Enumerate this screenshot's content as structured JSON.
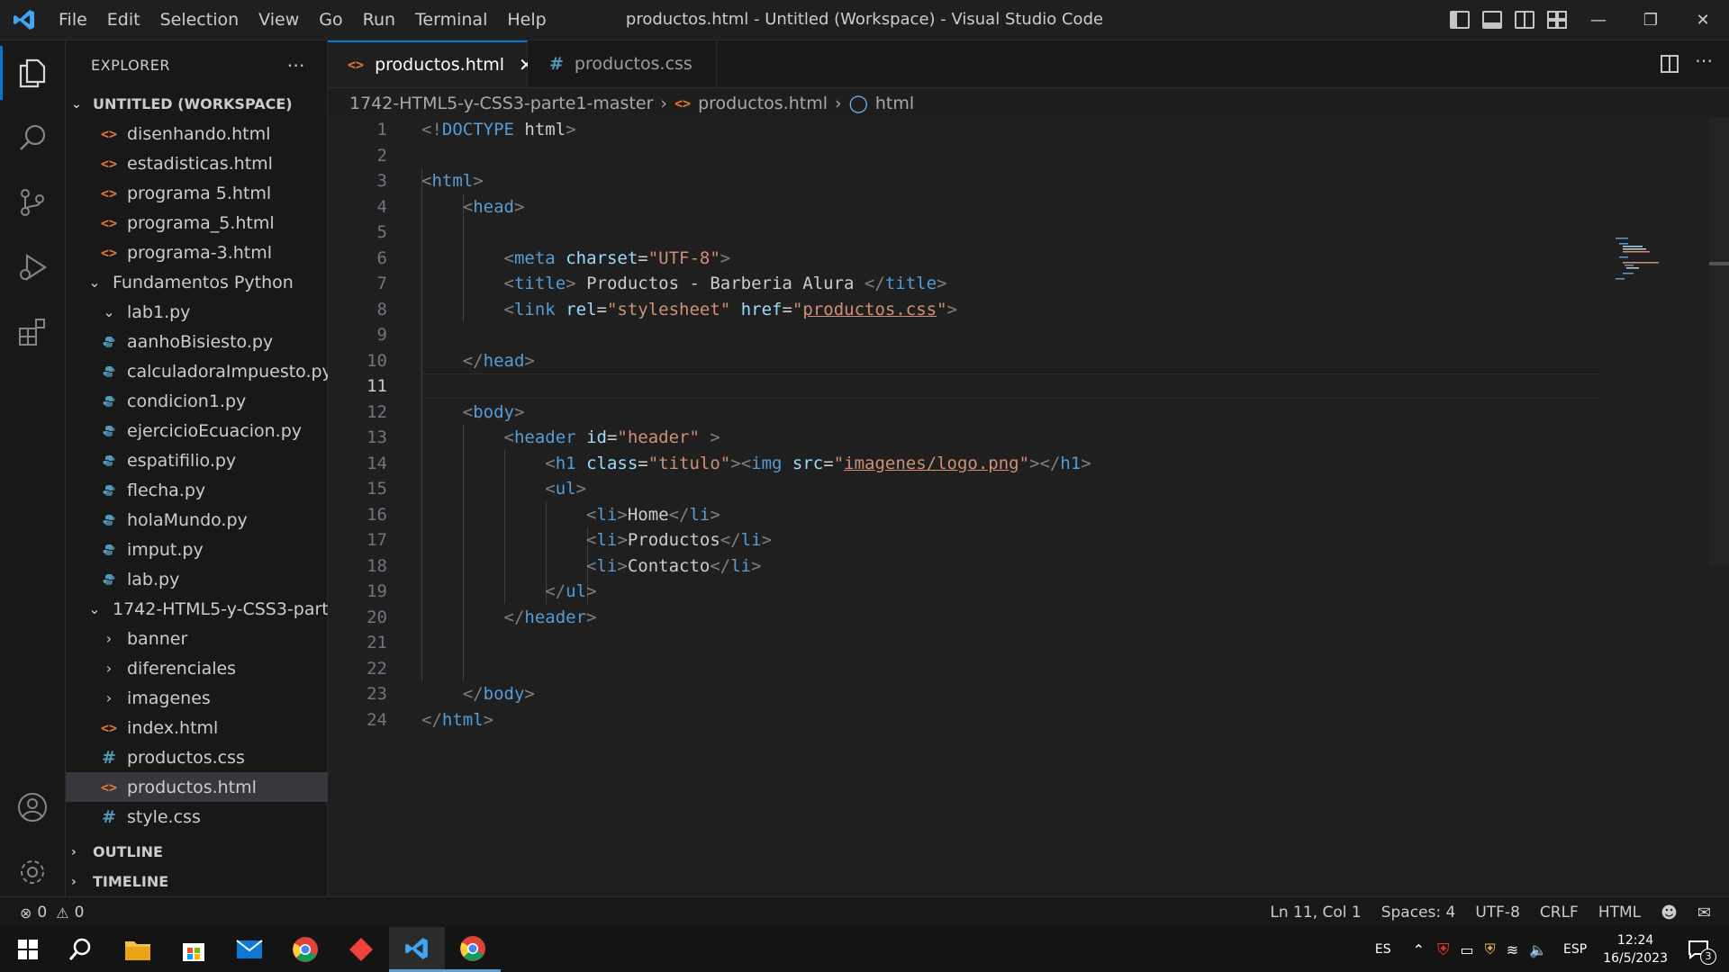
{
  "window": {
    "title": "productos.html - Untitled (Workspace) - Visual Studio Code",
    "menu": [
      "File",
      "Edit",
      "Selection",
      "View",
      "Go",
      "Run",
      "Terminal",
      "Help"
    ]
  },
  "sidebar": {
    "header": "EXPLORER",
    "workspace": "UNTITLED (WORKSPACE)",
    "tree": [
      {
        "label": "disenhando.html",
        "type": "html"
      },
      {
        "label": "estadisticas.html",
        "type": "html"
      },
      {
        "label": "programa 5.html",
        "type": "html"
      },
      {
        "label": "programa_5.html",
        "type": "html"
      },
      {
        "label": "programa-3.html",
        "type": "html"
      },
      {
        "label": "Fundamentos Python",
        "type": "folder-open"
      },
      {
        "label": "lab1.py",
        "type": "folder-open"
      },
      {
        "label": "aanhoBisiesto.py",
        "type": "py"
      },
      {
        "label": "calculadoraImpuesto.py",
        "type": "py"
      },
      {
        "label": "condicion1.py",
        "type": "py"
      },
      {
        "label": "ejercicioEcuacion.py",
        "type": "py"
      },
      {
        "label": "espatifilio.py",
        "type": "py"
      },
      {
        "label": "flecha.py",
        "type": "py"
      },
      {
        "label": "holaMundo.py",
        "type": "py"
      },
      {
        "label": "imput.py",
        "type": "py"
      },
      {
        "label": "lab.py",
        "type": "py"
      },
      {
        "label": "1742-HTML5-y-CSS3-part...",
        "type": "folder-open"
      },
      {
        "label": "banner",
        "type": "folder-closed"
      },
      {
        "label": "diferenciales",
        "type": "folder-closed"
      },
      {
        "label": "imagenes",
        "type": "folder-closed"
      },
      {
        "label": "index.html",
        "type": "html"
      },
      {
        "label": "productos.css",
        "type": "css"
      },
      {
        "label": "productos.html",
        "type": "html"
      },
      {
        "label": "style.css",
        "type": "css"
      }
    ],
    "outline": "OUTLINE",
    "timeline": "TIMELINE"
  },
  "tabs": [
    {
      "label": "productos.html",
      "active": true
    },
    {
      "label": "productos.css",
      "active": false
    }
  ],
  "breadcrumb": [
    "1742-HTML5-y-CSS3-parte1-master",
    "productos.html",
    "html"
  ],
  "editor": {
    "current_line": 11,
    "lines": [
      {
        "n": "1"
      },
      {
        "n": "2"
      },
      {
        "n": "3"
      },
      {
        "n": "4"
      },
      {
        "n": "5"
      },
      {
        "n": "6"
      },
      {
        "n": "7"
      },
      {
        "n": "8"
      },
      {
        "n": "9"
      },
      {
        "n": "10"
      },
      {
        "n": "11"
      },
      {
        "n": "12"
      },
      {
        "n": "13"
      },
      {
        "n": "14"
      },
      {
        "n": "15"
      },
      {
        "n": "16"
      },
      {
        "n": "17"
      },
      {
        "n": "18"
      },
      {
        "n": "19"
      },
      {
        "n": "20"
      },
      {
        "n": "21"
      },
      {
        "n": "22"
      },
      {
        "n": "23"
      },
      {
        "n": "24"
      }
    ],
    "code": {
      "doctype": "DOCTYPE",
      "doctype_html": "html",
      "html": "html",
      "head": "head",
      "meta": "meta",
      "charset": "charset",
      "charset_val": "\"UTF-8\"",
      "title": "title",
      "title_text": " Productos - Barberia Alura ",
      "link": "link",
      "rel": "rel",
      "rel_val": "\"stylesheet\"",
      "href": "href",
      "href_val": "productos.css",
      "body": "body",
      "header": "header",
      "id": "id",
      "id_val": "\"header\"",
      "h1": "h1",
      "class": "class",
      "class_val": "\"titulo\"",
      "img": "img",
      "src": "src",
      "src_val": "imagenes/logo.png",
      "ul": "ul",
      "li": "li",
      "li_1": "Home",
      "li_2": "Productos",
      "li_3": "Contacto"
    }
  },
  "status": {
    "errors": "0",
    "warnings": "0",
    "position": "Ln 11, Col 1",
    "spaces": "Spaces: 4",
    "encoding": "UTF-8",
    "eol": "CRLF",
    "language": "HTML"
  },
  "taskbar": {
    "lang": "ES",
    "keyboard": "ESP",
    "time": "12:24",
    "date": "16/5/2023",
    "notifications": "3"
  }
}
